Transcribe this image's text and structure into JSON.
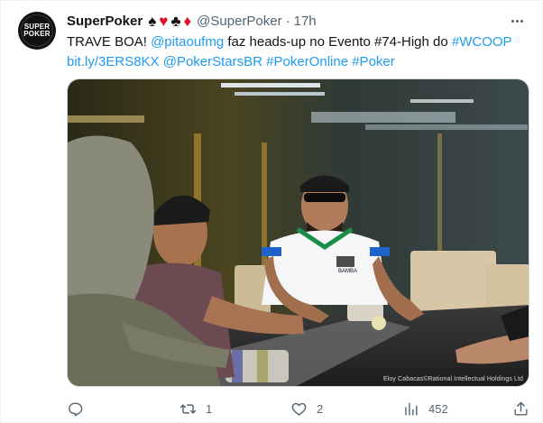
{
  "tweet": {
    "author_name": "SuperPoker",
    "author_logo_text": "SUPER POKER",
    "suits": [
      "♠",
      "♥",
      "♣",
      "♦"
    ],
    "handle": "@SuperPoker",
    "separator": "·",
    "time": "17h",
    "text": {
      "prefix": "TRAVE BOA! ",
      "mention1": "@pitaoufmg",
      "middle": " faz heads-up no Evento #74-High do ",
      "hashtag1": "#WCOOP",
      "link": "bit.ly/3ERS8KX",
      "mention2": "@PokerStarsBR",
      "hashtag2": "#PokerOnline",
      "hashtag3": "#Poker"
    },
    "photo_credit": "Eloy Cabacas©Rational Intellectual Holdings Ltd",
    "jersey_text": "BAMBA"
  },
  "actions": {
    "reply_count": "",
    "retweet_count": "1",
    "like_count": "2",
    "views_count": "452"
  },
  "colors": {
    "link": "#1d9bf0",
    "secondary_text": "#536471",
    "red_suit": "#e0102b"
  },
  "icons": [
    "more-icon",
    "reply-icon",
    "retweet-icon",
    "like-icon",
    "views-icon",
    "share-icon"
  ]
}
